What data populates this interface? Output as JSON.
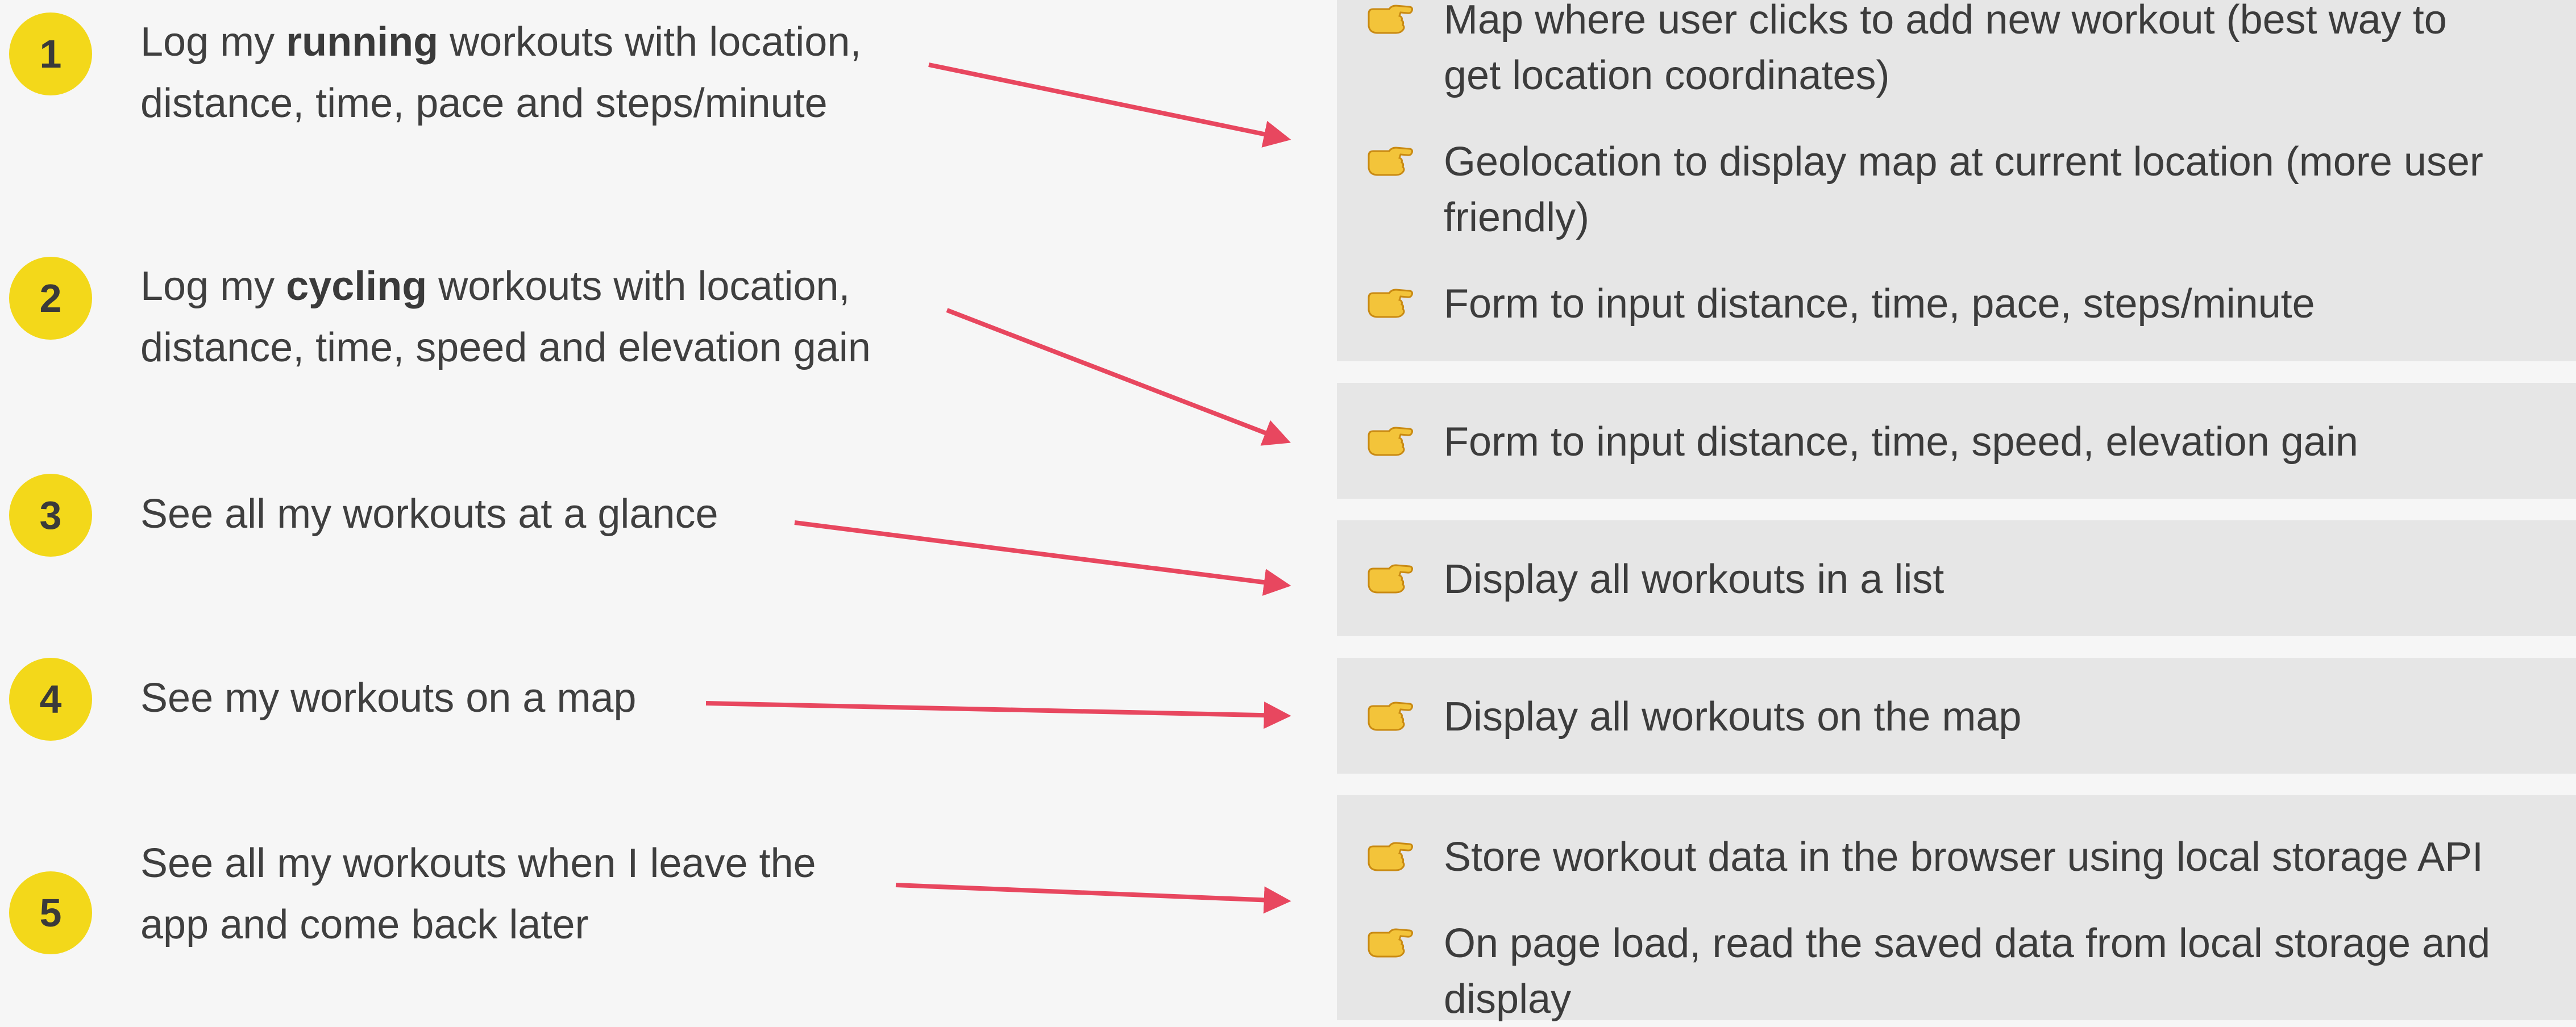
{
  "colors": {
    "background": "#f6f6f6",
    "badge": "#f3d81a",
    "panel": "#e6e6e6",
    "arrow": "#e8475f",
    "text": "#3f3f3f"
  },
  "stories": [
    {
      "number": "1",
      "pre": "Log my ",
      "bold": "running",
      "post": " workouts with location,",
      "line2": "distance, time, pace and steps/minute"
    },
    {
      "number": "2",
      "pre": "Log my ",
      "bold": "cycling",
      "post": " workouts with location,",
      "line2": "distance, time, speed and elevation gain"
    },
    {
      "number": "3",
      "pre": "See all my workouts at a glance",
      "bold": "",
      "post": "",
      "line2": ""
    },
    {
      "number": "4",
      "pre": "See my workouts on a map",
      "bold": "",
      "post": "",
      "line2": ""
    },
    {
      "number": "5",
      "pre": "See all my workouts when I leave the",
      "bold": "",
      "post": "",
      "line2": "app and come back later"
    }
  ],
  "features": [
    {
      "icon": "pointing-hand-icon",
      "line1": "Map where user clicks to add new workout (best way to",
      "line2": "get location coordinates)"
    },
    {
      "icon": "pointing-hand-icon",
      "line1": "Geolocation to display map at current location (more user",
      "line2": "friendly)"
    },
    {
      "icon": "pointing-hand-icon",
      "line1": "Form to input distance, time, pace, steps/minute",
      "line2": ""
    },
    {
      "icon": "pointing-hand-icon",
      "line1": "Form to input distance, time, speed, elevation gain",
      "line2": ""
    },
    {
      "icon": "pointing-hand-icon",
      "line1": "Display all workouts in a list",
      "line2": ""
    },
    {
      "icon": "pointing-hand-icon",
      "line1": "Display all workouts on the map",
      "line2": ""
    },
    {
      "icon": "pointing-hand-icon",
      "line1": "Store workout data in the browser using local storage API",
      "line2": ""
    },
    {
      "icon": "pointing-hand-icon",
      "line1": "On page load, read the saved data from local storage and",
      "line2": "display"
    }
  ]
}
